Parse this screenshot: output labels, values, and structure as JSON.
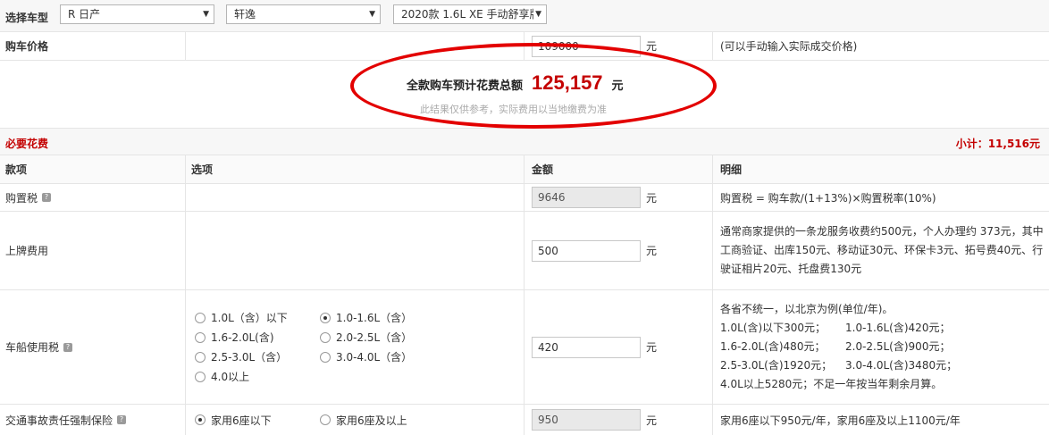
{
  "selector": {
    "label": "选择车型",
    "brand": "R 日产",
    "series": "轩逸",
    "model": "2020款 1.6L XE 手动舒享版"
  },
  "price_row": {
    "label": "购车价格",
    "value": "109000",
    "unit": "元",
    "note": "(可以手动输入实际成交价格)"
  },
  "summary": {
    "label": "全款购车预计花费总额",
    "value": "125,157",
    "unit": "元",
    "note": "此结果仅供参考，实际费用以当地缴费为准"
  },
  "section": {
    "title": "必要花费",
    "subtotal": "小计：11,516元"
  },
  "columns": [
    "款项",
    "选项",
    "金额",
    "明细"
  ],
  "purchase_tax": {
    "label": "购置税",
    "value": "9646",
    "unit": "元",
    "detail": "购置税 = 购车款/(1+13%)×购置税率(10%)"
  },
  "registration": {
    "label": "上牌费用",
    "value": "500",
    "unit": "元",
    "detail_lines": [
      "通常商家提供的一条龙服务收费约500元，个人办理约 373元，其中",
      "工商验证、出库150元、移动证30元、环保卡3元、拓号费40元、行",
      "驶证相片20元、托盘费130元"
    ]
  },
  "vehicle_tax": {
    "label": "车船使用税",
    "options": [
      "1.0L（含）以下",
      "1.0-1.6L（含）",
      "1.6-2.0L(含)",
      "2.0-2.5L（含）",
      "2.5-3.0L（含）",
      "3.0-4.0L（含）",
      "4.0以上"
    ],
    "selected_index": 1,
    "value": "420",
    "unit": "元",
    "detail_intro": "各省不统一，以北京为例(单位/年)。",
    "detail_pairs": [
      [
        "1.0L(含)以下300元；",
        "1.0-1.6L(含)420元；"
      ],
      [
        "1.6-2.0L(含)480元；",
        "2.0-2.5L(含)900元；"
      ],
      [
        "2.5-3.0L(含)1920元；",
        "3.0-4.0L(含)3480元；"
      ]
    ],
    "detail_end": "4.0L以上5280元；不足一年按当年剩余月算。"
  },
  "insurance": {
    "label": "交通事故责任强制保险",
    "options": [
      "家用6座以下",
      "家用6座及以上"
    ],
    "selected_index": 0,
    "value": "950",
    "unit": "元",
    "detail": "家用6座以下950元/年，家用6座及以上1100元/年"
  },
  "icons": {
    "help": "help-icon",
    "dropdown": "dropdown-arrow-icon",
    "radio": "radio-icon"
  },
  "colors": {
    "accent_red": "#c40000",
    "highlight_ellipse": "#e30000"
  }
}
